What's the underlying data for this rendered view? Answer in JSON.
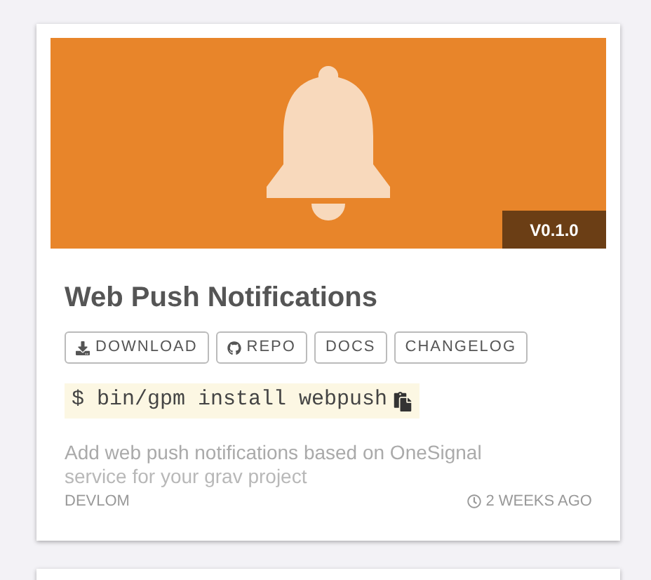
{
  "card": {
    "version_badge": "V0.1.0",
    "title": "Web Push Notifications",
    "buttons": [
      {
        "label": "DOWNLOAD",
        "kind": "download"
      },
      {
        "label": "REPO",
        "kind": "github"
      },
      {
        "label": "DOCS",
        "kind": "plain"
      },
      {
        "label": "CHANGELOG",
        "kind": "plain"
      }
    ],
    "command": "$ bin/gpm install webpush",
    "description": [
      "Add web push notifications based on OneSignal",
      "service for your grav project"
    ],
    "author": "DEVLOM",
    "time": "2 WEEKS AGO"
  }
}
